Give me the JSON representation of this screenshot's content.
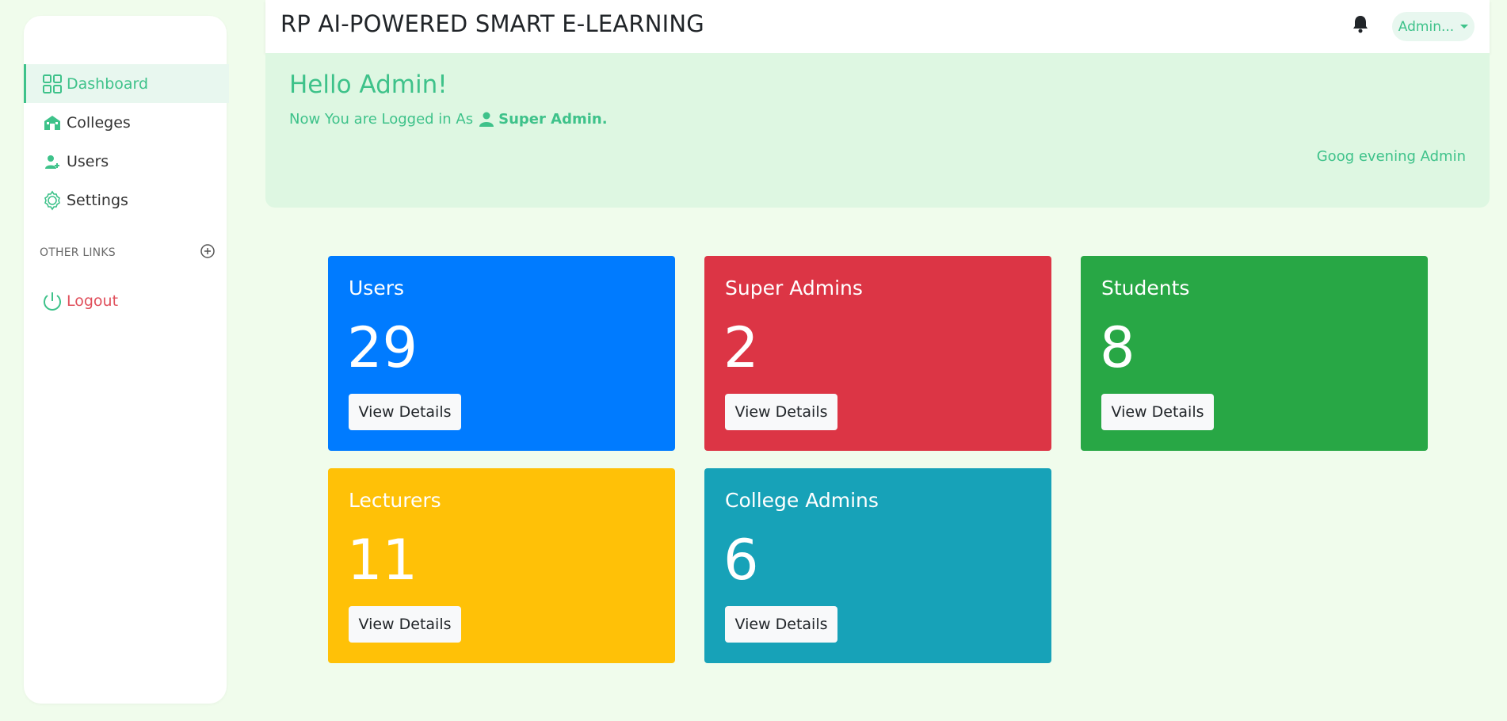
{
  "app": {
    "title": "RP AI-POWERED SMART E-LEARNING"
  },
  "sidebar": {
    "items": [
      {
        "label": "Dashboard",
        "icon": "grid-icon",
        "active": true
      },
      {
        "label": "Colleges",
        "icon": "building-icon"
      },
      {
        "label": "Users",
        "icon": "user-plus-icon"
      },
      {
        "label": "Settings",
        "icon": "gear-icon"
      }
    ],
    "other_links_label": "OTHER LINKS",
    "logout_label": "Logout"
  },
  "header": {
    "user_menu_label": "Admin..."
  },
  "welcome": {
    "hello": "Hello Admin!",
    "logged_prefix": "Now You are Logged in As",
    "role": "Super Admin.",
    "greeting": "Goog evening Admin"
  },
  "cards": [
    {
      "title": "Users",
      "count": "29",
      "button": "View Details",
      "color": "#007bff"
    },
    {
      "title": "Super Admins",
      "count": "2",
      "button": "View Details",
      "color": "#dc3545"
    },
    {
      "title": "Students",
      "count": "8",
      "button": "View Details",
      "color": "#28a745"
    },
    {
      "title": "Lecturers",
      "count": "11",
      "button": "View Details",
      "color": "#ffc107"
    },
    {
      "title": "College Admins",
      "count": "6",
      "button": "View Details",
      "color": "#17a2b8"
    }
  ],
  "colors": {
    "accent": "#3ec28a",
    "page_bg": "#f0fcec",
    "welcome_bg": "#def7e2",
    "logout": "#e0505c"
  }
}
